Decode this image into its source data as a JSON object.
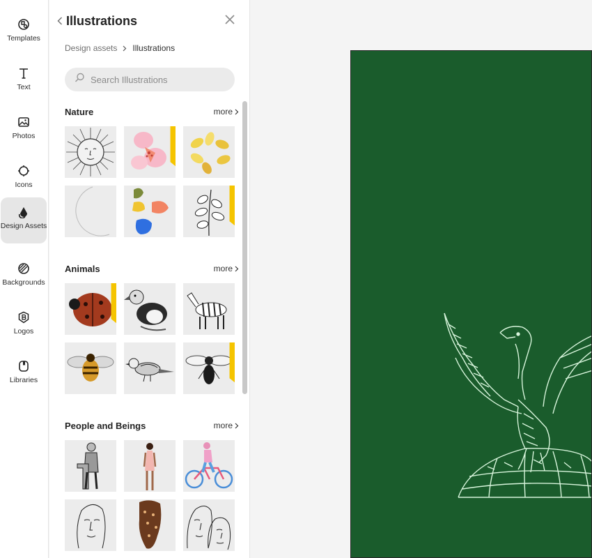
{
  "rail": {
    "items": [
      {
        "label": "Templates",
        "icon": "templates-icon"
      },
      {
        "label": "Text",
        "icon": "text-icon"
      },
      {
        "label": "Photos",
        "icon": "photos-icon"
      },
      {
        "label": "Icons",
        "icon": "icons-icon"
      },
      {
        "label": "Design Assets",
        "icon": "design-assets-icon",
        "active": true
      },
      {
        "label": "Backgrounds",
        "icon": "backgrounds-icon"
      },
      {
        "label": "Logos",
        "icon": "logos-icon"
      },
      {
        "label": "Libraries",
        "icon": "libraries-icon"
      }
    ]
  },
  "panel": {
    "title": "Illustrations",
    "breadcrumb": {
      "parent": "Design assets",
      "current": "Illustrations"
    },
    "search": {
      "placeholder": "Search Illustrations",
      "value": ""
    },
    "more_label": "more",
    "sections": [
      {
        "title": "Nature",
        "items": [
          {
            "name": "sun-face",
            "premium": false
          },
          {
            "name": "pink-flowers",
            "premium": true
          },
          {
            "name": "yellow-petals",
            "premium": false
          },
          {
            "name": "crescent-moon",
            "premium": false
          },
          {
            "name": "colorful-leaves",
            "premium": false
          },
          {
            "name": "leaf-branch",
            "premium": true
          }
        ]
      },
      {
        "title": "Animals",
        "items": [
          {
            "name": "ladybug",
            "premium": true
          },
          {
            "name": "puffin",
            "premium": false
          },
          {
            "name": "zebra",
            "premium": false
          },
          {
            "name": "bee",
            "premium": false
          },
          {
            "name": "sparrow",
            "premium": false
          },
          {
            "name": "wasp",
            "premium": true
          }
        ]
      },
      {
        "title": "People and Beings",
        "items": [
          {
            "name": "engraved-man",
            "premium": false
          },
          {
            "name": "woman-standing",
            "premium": false
          },
          {
            "name": "cyclist",
            "premium": false
          },
          {
            "name": "line-face",
            "premium": false
          },
          {
            "name": "braided-hair",
            "premium": false
          },
          {
            "name": "two-line-faces",
            "premium": false
          }
        ]
      }
    ]
  },
  "canvas": {
    "background": "#1a5c2c",
    "illustration": "eagle-on-globe"
  },
  "colors": {
    "accent_premium": "#f5c400",
    "canvas_green": "#1a5c2c",
    "engraving_mint": "#d8f5dc"
  }
}
